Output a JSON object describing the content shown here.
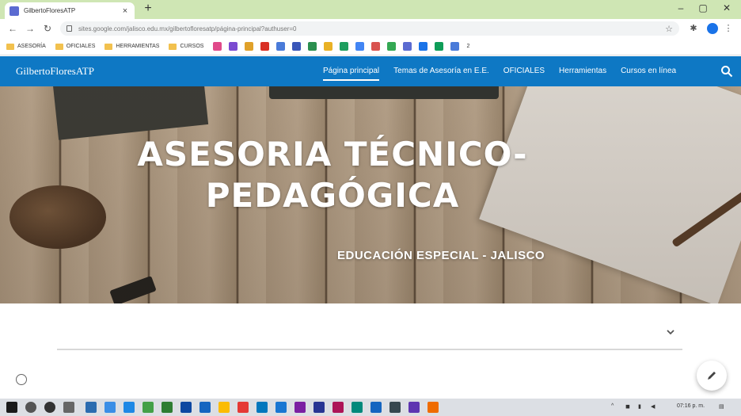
{
  "browser": {
    "tab_title": "GilbertoFloresATP",
    "tab_close": "×",
    "new_tab": "+",
    "url": "sites.google.com/jalisco.edu.mx/gilbertofloresatp/página-principal?authuser=0",
    "bookmarks": [
      "ASESORÍA",
      "OFICIALES",
      "HERRAMIENTAS",
      "CURSOS"
    ],
    "bookmark_overflow": "2",
    "accent": "#1a73e8",
    "tabstrip_color": "#cfe6b4"
  },
  "site": {
    "title": "GilbertoFloresATP",
    "nav": [
      {
        "label": "Página principal",
        "active": true
      },
      {
        "label": "Temas de Asesoría en E.E.",
        "active": false
      },
      {
        "label": "OFICIALES",
        "active": false
      },
      {
        "label": "Herramientas",
        "active": false
      },
      {
        "label": "Cursos en línea",
        "active": false
      }
    ],
    "nav_color": "#0e78c4"
  },
  "hero": {
    "title_line1": "ASESORIA TÉCNICO-",
    "title_line2": "PEDAGÓGICA",
    "subtitle": "EDUCACIÓN ESPECIAL - JALISCO"
  },
  "taskbar": {
    "time": "07:16 p. m."
  }
}
